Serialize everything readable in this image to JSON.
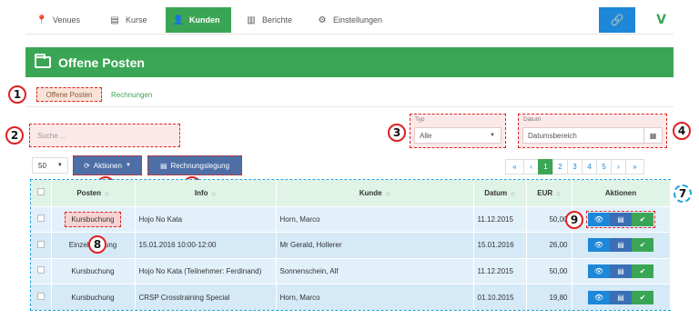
{
  "nav": {
    "items": [
      {
        "label": "Venues",
        "icon": "map-pin-icon"
      },
      {
        "label": "Kurse",
        "icon": "list-icon"
      },
      {
        "label": "Kunden",
        "icon": "user-icon"
      },
      {
        "label": "Berichte",
        "icon": "bar-chart-icon"
      },
      {
        "label": "Einstellungen",
        "icon": "gears-icon"
      }
    ],
    "active": "Kunden",
    "logo": "V"
  },
  "page": {
    "title": "Offene Posten"
  },
  "tabs": [
    {
      "label": "Offene Posten",
      "active": true
    },
    {
      "label": "Rechnungen",
      "active": false
    }
  ],
  "search": {
    "placeholder": "Suche ..."
  },
  "filters": {
    "typ": {
      "label": "Typ",
      "value": "Alle"
    },
    "datum": {
      "label": "Datum",
      "placeholder": "Datumsbereich"
    }
  },
  "toolbar": {
    "per_page": "50",
    "aktionen_label": "Aktionen",
    "rechnungslegung_label": "Rechnungslegung"
  },
  "pagination": {
    "first": "«",
    "prev": "‹",
    "pages": [
      "1",
      "2",
      "3",
      "4",
      "5"
    ],
    "next": "›",
    "last": "»",
    "current": "1"
  },
  "table": {
    "headers": [
      "Posten",
      "Info",
      "Kunde",
      "Datum",
      "EUR",
      "Aktionen"
    ],
    "rows": [
      {
        "posten": "Kursbuchung",
        "info": "Hojo No Kata",
        "kunde": "Horn, Marco",
        "datum": "11.12.2015",
        "eur": "50,00"
      },
      {
        "posten": "Einzelbuchung",
        "info": "15.01.2016 10:00-12:00",
        "kunde": "Mr Gerald, Hollerer",
        "datum": "15.01.2016",
        "eur": "26,00"
      },
      {
        "posten": "Kursbuchung",
        "info": "Hojo No Kata (Teilnehmer: Ferdinand)",
        "kunde": "Sonnenschein, Alf",
        "datum": "11.12.2015",
        "eur": "50,00"
      },
      {
        "posten": "Kursbuchung",
        "info": "CRSP Crosstraining Special",
        "kunde": "Horn, Marco",
        "datum": "01.10.2015",
        "eur": "19,80"
      }
    ]
  },
  "callouts": [
    "1",
    "2",
    "3",
    "4",
    "5",
    "6",
    "7",
    "8",
    "9"
  ],
  "colors": {
    "accent": "#3aa655",
    "primary": "#1d87d8",
    "annotation": "#e02020",
    "table_outline": "#1fa3e0"
  }
}
